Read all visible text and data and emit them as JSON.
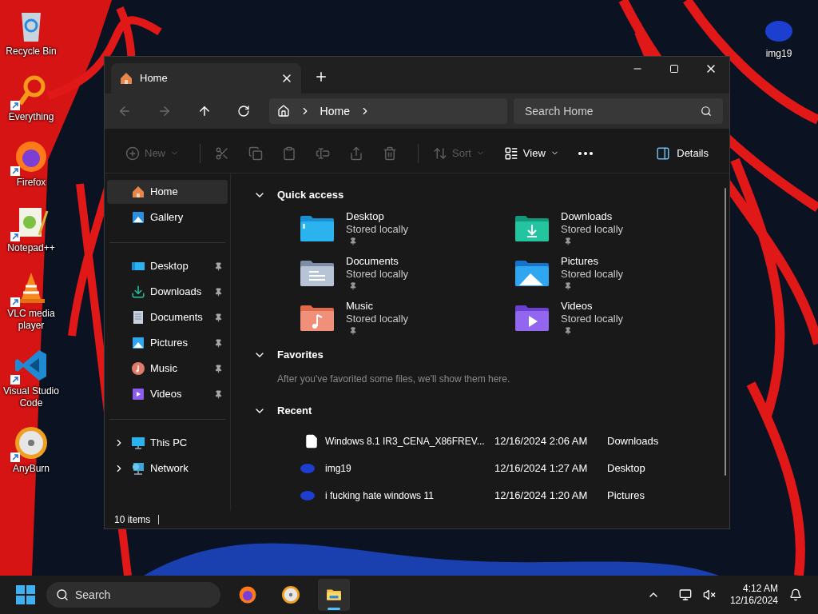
{
  "desktop_icons": [
    {
      "label": "Recycle Bin",
      "kind": "bin",
      "shortcut": false
    },
    {
      "label": "Everything",
      "kind": "everything",
      "shortcut": true
    },
    {
      "label": "Firefox",
      "kind": "firefox",
      "shortcut": true
    },
    {
      "label": "Notepad++",
      "kind": "notepad",
      "shortcut": true
    },
    {
      "label": "VLC media player",
      "kind": "vlc",
      "shortcut": true
    },
    {
      "label": "Visual Studio Code",
      "kind": "vscode",
      "shortcut": true
    },
    {
      "label": "AnyBurn",
      "kind": "disc",
      "shortcut": true
    }
  ],
  "desktop_icon_right": {
    "label": "img19"
  },
  "window": {
    "tabs": [
      {
        "label": "Home",
        "selected": true
      }
    ],
    "address": {
      "crumbs": [
        "Home"
      ]
    },
    "search": {
      "placeholder": "Search Home"
    },
    "toolbar": [
      {
        "kind": "new",
        "label": "New",
        "disabled": true
      },
      {
        "kind": "cut",
        "disabled": true
      },
      {
        "kind": "copy",
        "disabled": true
      },
      {
        "kind": "paste",
        "disabled": true
      },
      {
        "kind": "rename",
        "disabled": true
      },
      {
        "kind": "share",
        "disabled": true
      },
      {
        "kind": "delete",
        "disabled": true
      },
      {
        "kind": "sort",
        "label": "Sort",
        "disabled": true
      },
      {
        "kind": "view",
        "label": "View",
        "disabled": false
      },
      {
        "kind": "more",
        "disabled": false
      }
    ],
    "details_button": {
      "label": "Details"
    },
    "sidebar": [
      [
        {
          "label": "Home",
          "kind": "home",
          "selected": true
        },
        {
          "label": "Gallery",
          "kind": "gallery",
          "selected": false
        }
      ],
      [
        {
          "label": "Desktop",
          "kind": "desktop",
          "selected": false,
          "pinned": true
        },
        {
          "label": "Downloads",
          "kind": "downloads",
          "selected": false,
          "pinned": true
        },
        {
          "label": "Documents",
          "kind": "documents",
          "selected": false,
          "pinned": true
        },
        {
          "label": "Pictures",
          "kind": "pictures",
          "selected": false,
          "pinned": true
        },
        {
          "label": "Music",
          "kind": "music",
          "selected": false,
          "pinned": true
        },
        {
          "label": "Videos",
          "kind": "videos",
          "selected": false,
          "pinned": true
        }
      ],
      [
        {
          "label": "This PC",
          "kind": "pc",
          "selected": false,
          "expanded": false
        },
        {
          "label": "Network",
          "kind": "network",
          "selected": false,
          "expanded": false
        }
      ]
    ],
    "quick_access": {
      "title": "Quick access",
      "expanded": true,
      "folders": [
        {
          "name": "Desktop",
          "status": "Stored locally",
          "kind": "desktop",
          "pinned": true
        },
        {
          "name": "Downloads",
          "status": "Stored locally",
          "kind": "downloads",
          "pinned": true
        },
        {
          "name": "Documents",
          "status": "Stored locally",
          "kind": "documents",
          "pinned": true
        },
        {
          "name": "Pictures",
          "status": "Stored locally",
          "kind": "pictures",
          "pinned": true
        },
        {
          "name": "Music",
          "status": "Stored locally",
          "kind": "music",
          "pinned": true
        },
        {
          "name": "Videos",
          "status": "Stored locally",
          "kind": "videos",
          "pinned": true
        }
      ]
    },
    "favorites": {
      "title": "Favorites",
      "expanded": true,
      "message": "After you've favorited some files, we'll show them here."
    },
    "recent": {
      "title": "Recent",
      "expanded": true,
      "rows": [
        {
          "name": "Windows 8.1 IR3_CENA_X86FREV...",
          "date": "12/16/2024 2:06 AM",
          "location": "Downloads",
          "kind": "file"
        },
        {
          "name": "img19",
          "date": "12/16/2024 1:27 AM",
          "location": "Desktop",
          "kind": "image"
        },
        {
          "name": "i fucking hate windows 11",
          "date": "12/16/2024 1:20 AM",
          "location": "Pictures",
          "kind": "image"
        }
      ]
    },
    "status_bar": {
      "count": "10 items"
    }
  },
  "taskbar": {
    "search": {
      "placeholder": "Search"
    },
    "apps": [
      {
        "kind": "firefox",
        "selected": false
      },
      {
        "kind": "disc",
        "selected": false
      },
      {
        "kind": "explorer",
        "selected": true
      }
    ],
    "time": "4:12 AM",
    "date": "12/16/2024"
  }
}
